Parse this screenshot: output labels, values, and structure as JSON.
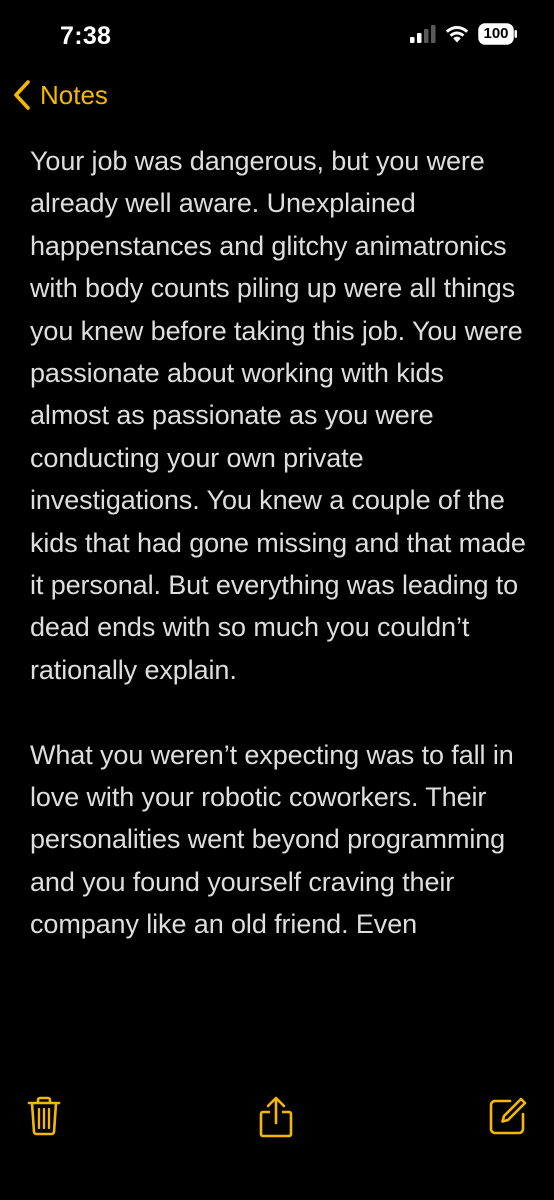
{
  "status_bar": {
    "time": "7:38",
    "battery": "100",
    "icons": [
      "signal-icon",
      "wifi-icon",
      "battery-icon"
    ]
  },
  "nav": {
    "back_label": "Notes",
    "back_icon": "chevron-left-icon"
  },
  "note": {
    "paragraphs": [
      "Your job was dangerous, but you were already well aware. Unexplained happenstances and glitchy animatronics with body counts piling up were all things you knew before taking this job. You were passionate about working with kids almost as passionate as you were conducting your own private investigations. You knew a couple of the kids that had gone missing and that made it personal. But everything was leading to dead ends with so much you couldn’t rationally explain.",
      "What you weren’t expecting was to fall in love with your robotic coworkers. Their personalities went beyond programming and you found yourself craving their company like an old friend. Even"
    ]
  },
  "toolbar": {
    "icons": [
      "trash-icon",
      "share-icon",
      "compose-icon"
    ]
  },
  "colors": {
    "accent": "#f5b800",
    "background": "#000000",
    "text": "#dedede"
  }
}
